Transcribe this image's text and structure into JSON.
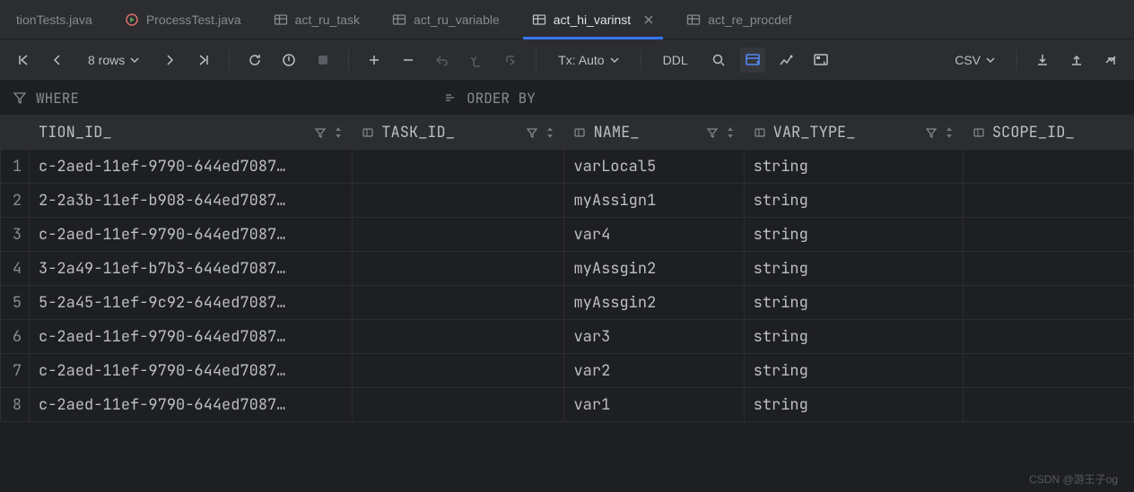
{
  "tabs": [
    {
      "label": "tionTests.java",
      "icon": "java"
    },
    {
      "label": "ProcessTest.java",
      "icon": "run"
    },
    {
      "label": "act_ru_task",
      "icon": "table"
    },
    {
      "label": "act_ru_variable",
      "icon": "table"
    },
    {
      "label": "act_hi_varinst",
      "icon": "table",
      "active": true,
      "closable": true
    },
    {
      "label": "act_re_procdef",
      "icon": "table"
    }
  ],
  "toolbar": {
    "rows_label": "8 rows",
    "tx_label": "Tx: Auto",
    "ddl_label": "DDL",
    "csv_label": "CSV"
  },
  "filters": {
    "where_label": "WHERE",
    "order_label": "ORDER BY"
  },
  "columns": [
    "TION_ID_",
    "TASK_ID_",
    "NAME_",
    "VAR_TYPE_",
    "SCOPE_ID_"
  ],
  "rows": [
    {
      "tion": "c-2aed-11ef-9790-644ed7087…",
      "task": "<null>",
      "name": "varLocal5",
      "type": "string",
      "scope": "<null>"
    },
    {
      "tion": "2-2a3b-11ef-b908-644ed7087…",
      "task": "<null>",
      "name": "myAssign1",
      "type": "string",
      "scope": "<null>"
    },
    {
      "tion": "c-2aed-11ef-9790-644ed7087…",
      "task": "<null>",
      "name": "var4",
      "type": "string",
      "scope": "<null>"
    },
    {
      "tion": "3-2a49-11ef-b7b3-644ed7087…",
      "task": "<null>",
      "name": "myAssgin2",
      "type": "string",
      "scope": "<null>"
    },
    {
      "tion": "5-2a45-11ef-9c92-644ed7087…",
      "task": "<null>",
      "name": "myAssgin2",
      "type": "string",
      "scope": "<null>"
    },
    {
      "tion": "c-2aed-11ef-9790-644ed7087…",
      "task": "<null>",
      "name": "var3",
      "type": "string",
      "scope": "<null>"
    },
    {
      "tion": "c-2aed-11ef-9790-644ed7087…",
      "task": "<null>",
      "name": "var2",
      "type": "string",
      "scope": "<null>"
    },
    {
      "tion": "c-2aed-11ef-9790-644ed7087…",
      "task": "<null>",
      "name": "var1",
      "type": "string",
      "scope": "<null>"
    }
  ],
  "watermark": "CSDN @游王子og"
}
